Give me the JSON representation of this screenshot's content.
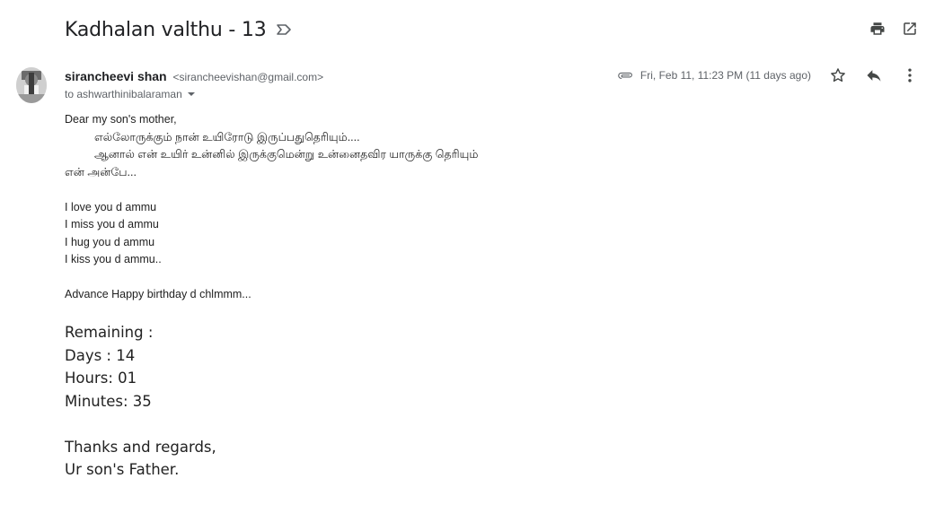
{
  "subject": "Kadhalan valthu - 13",
  "sender": {
    "name": "sirancheevi shan",
    "email": "<sirancheevishan@gmail.com>"
  },
  "recipient": "to ashwarthinibalaraman",
  "date": "Fri, Feb 11, 11:23 PM (11 days ago)",
  "icons": {
    "important": "important-marker-icon",
    "print": "print-icon",
    "open_new_window": "open-in-new-window-icon",
    "attachment": "paperclip-icon",
    "star": "star-icon",
    "reply": "reply-icon",
    "more": "more-vert-icon"
  },
  "body": {
    "greeting": "Dear my son's mother,",
    "tamil_line1": "எல்லோருக்கும் நான் உயிரோடு இருப்பதுதெரியும்....",
    "tamil_line2": "ஆனால் என் உயிர் உன்னில் இருக்குமென்று உன்னைதவிர யாருக்கு தெரியும்",
    "tamil_line3": "என் அன்பே...",
    "love1": "I love you d ammu",
    "love2": "I miss you d ammu",
    "love3": "I hug you d ammu",
    "love4": "I kiss you d ammu..",
    "wish": "Advance Happy birthday d chlmmm...",
    "remaining": "Remaining :",
    "days": "Days : 14",
    "hours": "Hours: 01",
    "minutes": "Minutes: 35",
    "closing": "Thanks and regards,",
    "signature": "Ur son's Father."
  },
  "colors": {
    "text": "#222222",
    "secondary": "#5f6368",
    "icon": "#444746"
  }
}
